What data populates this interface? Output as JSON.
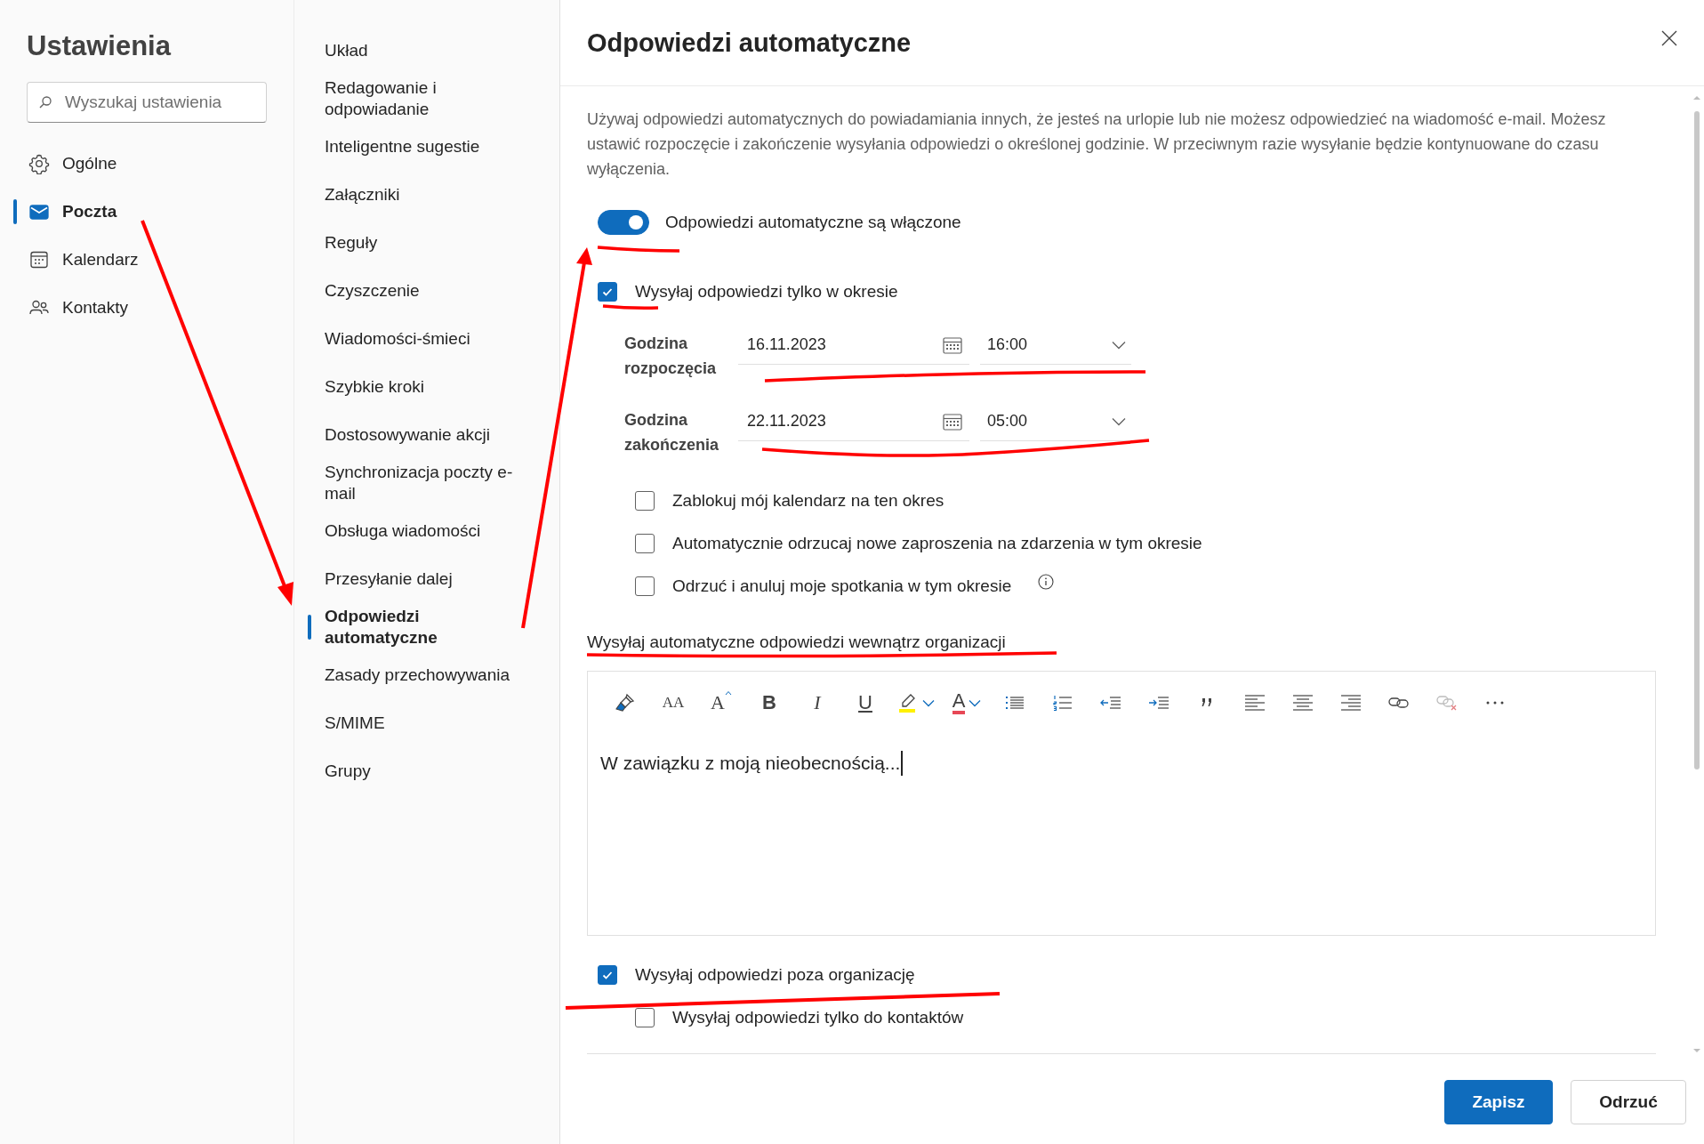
{
  "settings_nav": {
    "title": "Ustawienia",
    "search": {
      "placeholder": "Wyszukaj ustawienia"
    },
    "items": [
      {
        "kind": "gear",
        "label": "Ogólne",
        "selected": false
      },
      {
        "kind": "mail",
        "label": "Poczta",
        "selected": true
      },
      {
        "kind": "calendar",
        "label": "Kalendarz",
        "selected": false
      },
      {
        "kind": "people",
        "label": "Kontakty",
        "selected": false
      }
    ]
  },
  "mail_nav": {
    "items": [
      {
        "label": "Układ",
        "selected": false
      },
      {
        "label": "Redagowanie i odpowiadanie",
        "selected": false
      },
      {
        "label": "Inteligentne sugestie",
        "selected": false
      },
      {
        "label": "Załączniki",
        "selected": false
      },
      {
        "label": "Reguły",
        "selected": false
      },
      {
        "label": "Czyszczenie",
        "selected": false
      },
      {
        "label": "Wiadomości-śmieci",
        "selected": false
      },
      {
        "label": "Szybkie kroki",
        "selected": false
      },
      {
        "label": "Dostosowywanie akcji",
        "selected": false
      },
      {
        "label": "Synchronizacja poczty e-mail",
        "selected": false
      },
      {
        "label": "Obsługa wiadomości",
        "selected": false
      },
      {
        "label": "Przesyłanie dalej",
        "selected": false
      },
      {
        "label": "Odpowiedzi automatyczne",
        "selected": true
      },
      {
        "label": "Zasady przechowywania",
        "selected": false
      },
      {
        "label": "S/MIME",
        "selected": false
      },
      {
        "label": "Grupy",
        "selected": false
      }
    ]
  },
  "panel": {
    "title": "Odpowiedzi automatyczne",
    "description": "Używaj odpowiedzi automatycznych do powiadamiania innych, że jesteś na urlopie lub nie możesz odpowiedzieć na wiadomość e-mail. Możesz ustawić rozpoczęcie i zakończenie wysyłania odpowiedzi o określonej godzinie. W przeciwnym razie wysyłanie będzie kontynuowane do czasu wyłączenia.",
    "toggle": {
      "label": "Odpowiedzi automatyczne są włączone",
      "on": true
    },
    "period": {
      "label": "Wysyłaj odpowiedzi tylko w okresie",
      "checked": true
    },
    "times": [
      {
        "label": "Godzina rozpoczęcia",
        "date": "16.11.2023",
        "time": "16:00"
      },
      {
        "label": "Godzina zakończenia",
        "date": "22.11.2023",
        "time": "05:00"
      }
    ],
    "options": [
      {
        "label": "Zablokuj mój kalendarz na ten okres",
        "checked": false,
        "info": false
      },
      {
        "label": "Automatycznie odrzucaj nowe zaproszenia na zdarzenia w tym okresie",
        "checked": false,
        "info": false
      },
      {
        "label": "Odrzuć i anuluj moje spotkania w tym okresie",
        "checked": false,
        "info": true
      }
    ],
    "internal": {
      "heading": "Wysyłaj automatyczne odpowiedzi wewnątrz organizacji",
      "toolbar": [
        {
          "kind": "painter"
        },
        {
          "kind": "font_size",
          "glyph": "AA"
        },
        {
          "kind": "grow",
          "glyph": "A"
        },
        {
          "kind": "bold",
          "glyph": "B"
        },
        {
          "kind": "italic",
          "glyph": "I"
        },
        {
          "kind": "underline",
          "glyph": "U"
        },
        {
          "kind": "highlight"
        },
        {
          "kind": "font_color",
          "glyph": "A"
        },
        {
          "kind": "bullets"
        },
        {
          "kind": "numbering"
        },
        {
          "kind": "outdent"
        },
        {
          "kind": "indent"
        },
        {
          "kind": "quote"
        },
        {
          "kind": "align_left"
        },
        {
          "kind": "align_center"
        },
        {
          "kind": "align_right"
        },
        {
          "kind": "link"
        },
        {
          "kind": "unlink"
        },
        {
          "kind": "more"
        }
      ],
      "body": "W zawiązku z moją nieobecnością..."
    },
    "external": {
      "label": "Wysyłaj odpowiedzi poza organizację",
      "checked": true
    },
    "contacts_only": {
      "label": "Wysyłaj odpowiedzi tylko do kontaktów",
      "checked": false
    }
  },
  "buttons": [
    {
      "label": "Zapisz",
      "kind": "primary"
    },
    {
      "label": "Odrzuć",
      "kind": "secondary"
    }
  ]
}
